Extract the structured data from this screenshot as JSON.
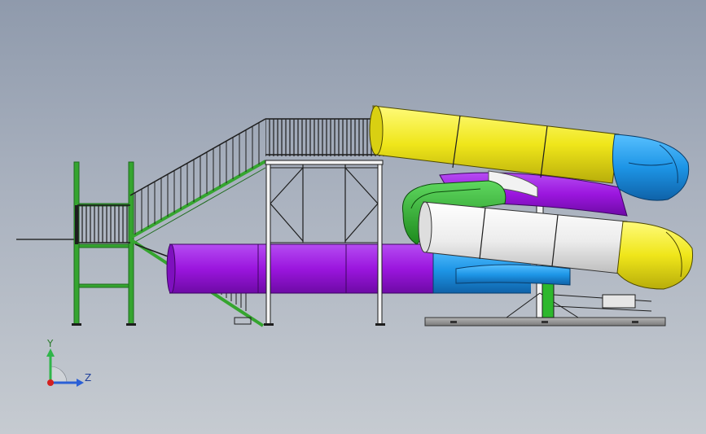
{
  "viewport": {
    "triad": {
      "y_label": "Y",
      "z_label": "Z",
      "y_color": "#2fb54a",
      "z_color": "#2a5fd6",
      "origin_color": "#d42020"
    }
  },
  "model": {
    "components": [
      {
        "name": "tower-frame",
        "color": "#2f9a2a"
      },
      {
        "name": "staircase",
        "color": "#2f9a2a"
      },
      {
        "name": "platform-frame",
        "color": "#ffffff"
      },
      {
        "name": "purple-tube",
        "color": "#a21fe0"
      },
      {
        "name": "blue-tube",
        "color": "#1d95e6"
      },
      {
        "name": "yellow-tube",
        "color": "#f2ec1c"
      },
      {
        "name": "white-tube",
        "color": "#eeeeee"
      },
      {
        "name": "green-tube",
        "color": "#2aa52a"
      },
      {
        "name": "base-plate",
        "color": "#8f8f8f"
      }
    ]
  }
}
